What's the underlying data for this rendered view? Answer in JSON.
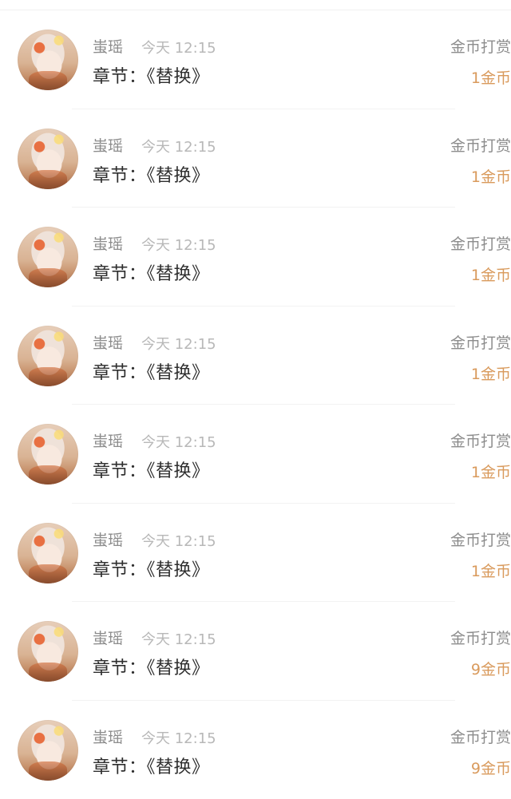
{
  "records": [
    {
      "user": "蚩瑶",
      "time": "今天 12:15",
      "chapter": "章节：《替换》",
      "type": "金币打赏",
      "amount": "1金币"
    },
    {
      "user": "蚩瑶",
      "time": "今天 12:15",
      "chapter": "章节：《替换》",
      "type": "金币打赏",
      "amount": "1金币"
    },
    {
      "user": "蚩瑶",
      "time": "今天 12:15",
      "chapter": "章节：《替换》",
      "type": "金币打赏",
      "amount": "1金币"
    },
    {
      "user": "蚩瑶",
      "time": "今天 12:15",
      "chapter": "章节：《替换》",
      "type": "金币打赏",
      "amount": "1金币"
    },
    {
      "user": "蚩瑶",
      "time": "今天 12:15",
      "chapter": "章节：《替换》",
      "type": "金币打赏",
      "amount": "1金币"
    },
    {
      "user": "蚩瑶",
      "time": "今天 12:15",
      "chapter": "章节：《替换》",
      "type": "金币打赏",
      "amount": "1金币"
    },
    {
      "user": "蚩瑶",
      "time": "今天 12:15",
      "chapter": "章节：《替换》",
      "type": "金币打赏",
      "amount": "9金币"
    },
    {
      "user": "蚩瑶",
      "time": "今天 12:15",
      "chapter": "章节：《替换》",
      "type": "金币打赏",
      "amount": "9金币"
    }
  ],
  "colors": {
    "accent": "#d99a5c",
    "muted": "#8d8d8d",
    "time": "#b8b8b8",
    "text": "#2e2e2e"
  }
}
